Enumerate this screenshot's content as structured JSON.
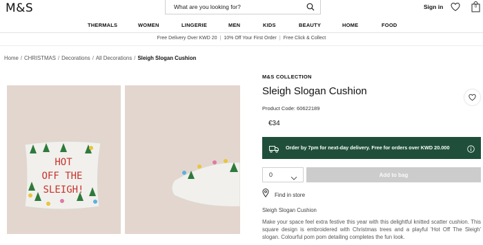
{
  "header": {
    "logo": "M&S",
    "search_placeholder": "What are you looking for?",
    "signin_label": "Sign in",
    "bag_count": "0"
  },
  "nav": {
    "items": [
      {
        "label": "THERMALS"
      },
      {
        "label": "WOMEN"
      },
      {
        "label": "LINGERIE"
      },
      {
        "label": "MEN"
      },
      {
        "label": "KIDS"
      },
      {
        "label": "BEAUTY"
      },
      {
        "label": "HOME"
      },
      {
        "label": "FOOD"
      }
    ]
  },
  "promo": {
    "items": [
      "Free Delivery Over KWD 20",
      "10% Off Your First Order",
      "Free Click & Collect"
    ],
    "separator": "|"
  },
  "breadcrumb": {
    "items": [
      "Home",
      "CHRISTMAS",
      "Decorations",
      "All Decorations"
    ],
    "current": "Sleigh Slogan Cushion",
    "separator": "/"
  },
  "gallery": {
    "cushion_text": [
      "HOT",
      "OFF THE",
      "SLEIGH!"
    ]
  },
  "product": {
    "collection": "M&S COLLECTION",
    "title": "Sleigh Slogan Cushion",
    "code": "Product Code: 60622189",
    "price": "€34",
    "delivery_message": "Order by 7pm for next-day delivery. Free for orders over KWD 20.000",
    "quantity": "0",
    "add_to_bag_label": "Add to bag",
    "find_in_store_label": "Find in store",
    "description_title": "Sleigh Slogan Cushion",
    "description": "Make your space feel extra festive this year with this delightful knitted scatter cushion. This square design is embroidered with Christmas trees and a playful 'Hot Off The Sleigh' slogan. Colourful pom pom detailing completes the fun look."
  },
  "colors": {
    "delivery_bg": "#1f4f3a",
    "add_to_bag_bg": "#cccccc",
    "image_bg": "#e3d6ce",
    "slogan_red": "#c8312b",
    "tree_green": "#2e7a3c"
  },
  "icons": {
    "search": "search-icon",
    "wishlist": "heart-icon",
    "bag": "shopping-bag-icon",
    "delivery": "truck-icon",
    "info": "info-icon",
    "location": "location-pin-icon",
    "chevron": "chevron-down-icon"
  }
}
